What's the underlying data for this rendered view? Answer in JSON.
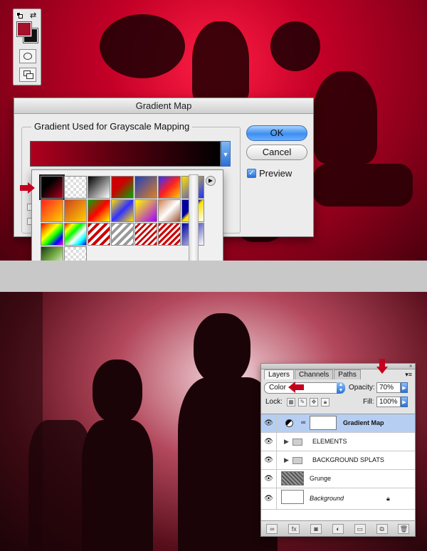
{
  "gradient_map_dialog": {
    "title": "Gradient Map",
    "group_label": "Gradient Used for Grayscale Mapping",
    "ok_label": "OK",
    "cancel_label": "Cancel",
    "preview_label": "Preview",
    "preview_checked": true
  },
  "gradient_picker": {
    "selected_index": 0,
    "swatches": [
      "linear-gradient(135deg,#000 0%,#000 35%,#b0001e 100%)",
      "repeating-conic-gradient(#ddd 0 25%,#fff 0 50%) 0 0/8px 8px, linear-gradient(135deg,#c00,transparent)",
      "linear-gradient(135deg,#000,#fff)",
      "linear-gradient(135deg,#c00 0%,#c00 40%,#0a0 100%)",
      "linear-gradient(135deg,#2040c0,#e08020)",
      "linear-gradient(135deg,#3030ff,#ff2020,#ffd000)",
      "linear-gradient(135deg,#ffe000,#2030ff)",
      "linear-gradient(135deg,#ff2020,#ffd000)",
      "linear-gradient(135deg,#d04020,#ffd000)",
      "linear-gradient(135deg,#0a0,#f00,#ff0)",
      "linear-gradient(135deg,#ffe000,#3030ff,#ffe000)",
      "linear-gradient(135deg,#ff0,#a000ff)",
      "linear-gradient(135deg,#d08050,#fff,#9a5030)",
      "linear-gradient(135deg,#0000a0 40%,#ffe000 50%,#fff 100%)",
      "linear-gradient(135deg,#f00,#f80,#ff0,#0f0,#00f,#f0f)",
      "linear-gradient(135deg,#f00,#ff0,#0f0,#fff,#0ff,#00f)",
      "repeating-linear-gradient(135deg,#c00 0 4px,#fff 4px 8px)",
      "repeating-linear-gradient(135deg,#999 0 4px,#fff 4px 8px)",
      "repeating-linear-gradient(135deg,#fff 0 3px,#c00 3px 6px)",
      "repeating-linear-gradient(135deg,#c00 0 3px,#fff 3px 6px)",
      "linear-gradient(135deg,#0000a0,#fff)",
      "linear-gradient(135deg,#1a3a10,#7ab04a,#fff)",
      "repeating-conic-gradient(#ddd 0 25%,#fff 0 50%) 0 0/8px 8px"
    ]
  },
  "layers_panel": {
    "tabs": [
      "Layers",
      "Channels",
      "Paths"
    ],
    "active_tab": 0,
    "blend_mode": "Color",
    "opacity_label": "Opacity:",
    "opacity_value": "70%",
    "lock_label": "Lock:",
    "fill_label": "Fill:",
    "fill_value": "100%",
    "layers": [
      {
        "name": "Gradient Map",
        "kind": "adjustment",
        "selected": true
      },
      {
        "name": "ELEMENTS",
        "kind": "group",
        "selected": false
      },
      {
        "name": "BACKGROUND SPLATS",
        "kind": "group",
        "selected": false
      },
      {
        "name": "Grunge",
        "kind": "pixel",
        "selected": false
      },
      {
        "name": "Background",
        "kind": "background",
        "selected": false,
        "locked": true
      }
    ]
  },
  "colors": {
    "foreground": "#a5102a",
    "background": "#111111",
    "annotation_arrow": "#c4001f"
  }
}
